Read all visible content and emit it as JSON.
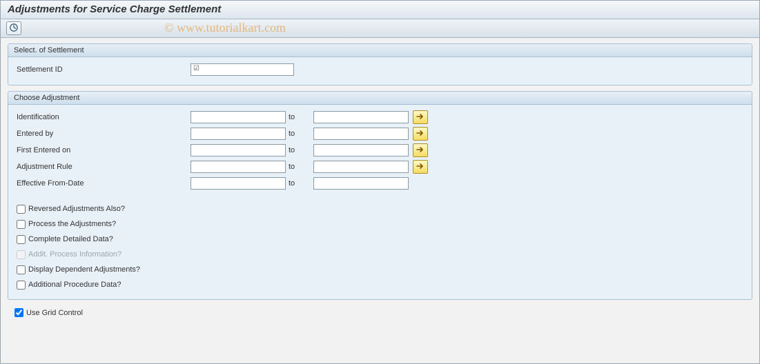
{
  "header": {
    "title": "Adjustments for Service Charge Settlement"
  },
  "watermark": "© www.tutorialkart.com",
  "group_settlement": {
    "title": "Select. of Settlement",
    "settlement_id_label": "Settlement ID",
    "settlement_id_value": ""
  },
  "group_adjustment": {
    "title": "Choose Adjustment",
    "to_label": "to",
    "rows": {
      "identification": {
        "label": "Identification",
        "low": "",
        "high": "",
        "multi": true
      },
      "entered_by": {
        "label": "Entered by",
        "low": "",
        "high": "",
        "multi": true
      },
      "first_entered": {
        "label": "First Entered on",
        "low": "",
        "high": "",
        "multi": true
      },
      "adj_rule": {
        "label": "Adjustment Rule",
        "low": "",
        "high": "",
        "multi": true
      },
      "eff_from": {
        "label": "Effective From-Date",
        "low": "",
        "high": "",
        "multi": false
      }
    },
    "checks": {
      "reversed": {
        "label": "Reversed Adjustments Also?",
        "checked": false,
        "enabled": true
      },
      "process": {
        "label": "Process the Adjustments?",
        "checked": false,
        "enabled": true
      },
      "complete": {
        "label": "Complete Detailed Data?",
        "checked": false,
        "enabled": true
      },
      "addit": {
        "label": "Addit. Process Information?",
        "checked": false,
        "enabled": false
      },
      "dependent": {
        "label": "Display Dependent Adjustments?",
        "checked": false,
        "enabled": true
      },
      "procedure": {
        "label": "Additional Procedure Data?",
        "checked": false,
        "enabled": true
      }
    }
  },
  "footer": {
    "grid_control": {
      "label": "Use Grid Control",
      "checked": true
    }
  }
}
